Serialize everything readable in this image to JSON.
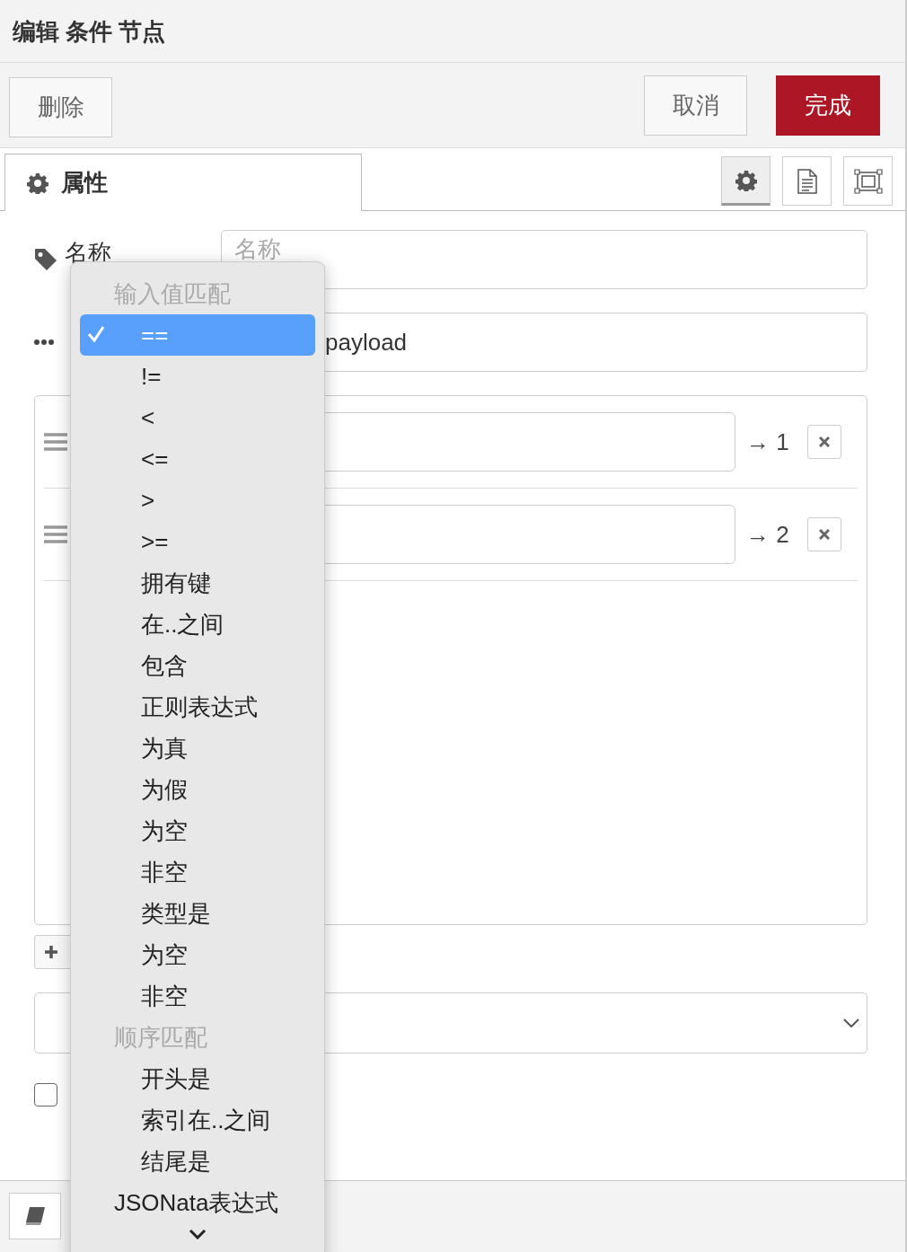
{
  "header": {
    "title": "编辑 条件 节点"
  },
  "toolbar": {
    "buttons": [
      {
        "label": "删除",
        "kind": "default"
      },
      {
        "label": "取消",
        "kind": "default"
      },
      {
        "label": "完成",
        "kind": "primary"
      }
    ]
  },
  "tabs": [
    {
      "label": "属性",
      "selected": true
    }
  ],
  "side_tabs": [
    {
      "selected": true
    },
    {
      "selected": false
    },
    {
      "selected": false
    }
  ],
  "form": {
    "name": {
      "label": "名称",
      "placeholder": "名称"
    },
    "property": {
      "value": "payload"
    }
  },
  "rules": [
    {
      "output": "→ 1"
    },
    {
      "output": "→ 2"
    }
  ],
  "options": {
    "checked": false
  },
  "menu": {
    "items": [
      {
        "kind": "header",
        "label": "输入值匹配"
      },
      {
        "kind": "option",
        "label": "==",
        "selected": true
      },
      {
        "kind": "option",
        "label": "!=",
        "selected": false
      },
      {
        "kind": "option",
        "label": "<",
        "selected": false
      },
      {
        "kind": "option",
        "label": "<=",
        "selected": false
      },
      {
        "kind": "option",
        "label": ">",
        "selected": false
      },
      {
        "kind": "option",
        "label": ">=",
        "selected": false
      },
      {
        "kind": "option",
        "label": "拥有键",
        "selected": false
      },
      {
        "kind": "option",
        "label": "在..之间",
        "selected": false
      },
      {
        "kind": "option",
        "label": "包含",
        "selected": false
      },
      {
        "kind": "option",
        "label": "正则表达式",
        "selected": false
      },
      {
        "kind": "option",
        "label": "为真",
        "selected": false
      },
      {
        "kind": "option",
        "label": "为假",
        "selected": false
      },
      {
        "kind": "option",
        "label": "为空",
        "selected": false
      },
      {
        "kind": "option",
        "label": "非空",
        "selected": false
      },
      {
        "kind": "option",
        "label": "类型是",
        "selected": false
      },
      {
        "kind": "option",
        "label": "为空",
        "selected": false
      },
      {
        "kind": "option",
        "label": "非空",
        "selected": false
      },
      {
        "kind": "header",
        "label": "顺序匹配"
      },
      {
        "kind": "option",
        "label": "开头是",
        "selected": false
      },
      {
        "kind": "option",
        "label": "索引在..之间",
        "selected": false
      },
      {
        "kind": "option",
        "label": "结尾是",
        "selected": false
      },
      {
        "kind": "top-option",
        "label": "JSONata表达式",
        "selected": false
      }
    ]
  }
}
